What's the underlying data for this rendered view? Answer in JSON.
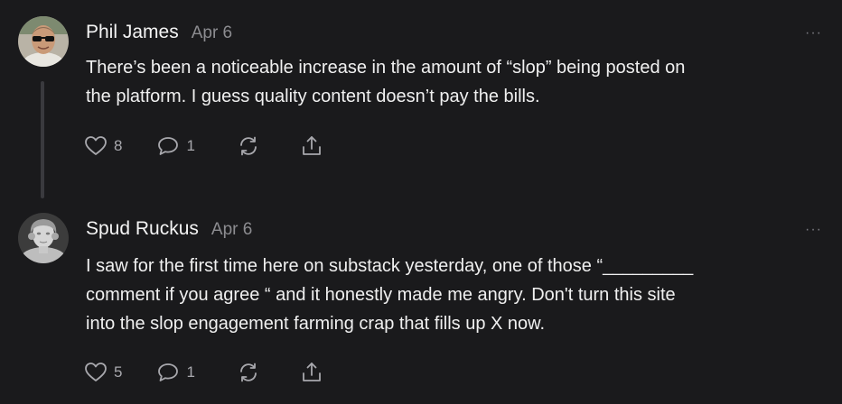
{
  "comments": [
    {
      "author": "Phil James",
      "date": "Apr 6",
      "text_lines": [
        "There’s been a noticeable increase in the amount of “slop” being posted on",
        "the platform. I guess quality content doesn’t pay the bills."
      ],
      "likes": "8",
      "replies": "1",
      "more_label": "···",
      "avatar_icon": "man-sunglasses-avatar"
    },
    {
      "author": "Spud Ruckus",
      "date": "Apr 6",
      "text_lines": [
        "I saw for the first time here on substack yesterday, one of those “_________",
        "comment if you agree “ and it honestly made me angry. Don't turn this site",
        "into the slop engagement farming crap that fills up X now."
      ],
      "likes": "5",
      "replies": "1",
      "more_label": "···",
      "avatar_icon": "statue-bust-avatar"
    }
  ],
  "colors": {
    "background": "#1a1a1c",
    "text": "#f0f0f0",
    "muted": "#8c8c90",
    "icon": "#a8a8ad"
  }
}
